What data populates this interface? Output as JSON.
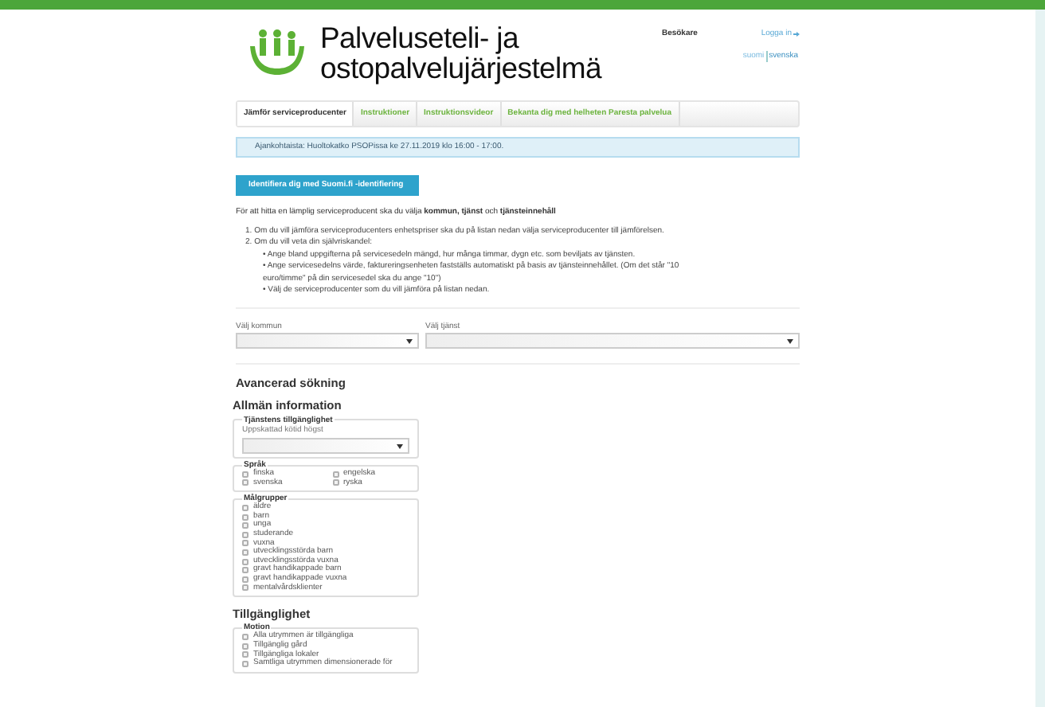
{
  "header": {
    "title_line1": "Palveluseteli- ja",
    "title_line2": "ostopalvelujärjestelmä",
    "user_label": "Besökare",
    "login_link": "Logga in",
    "languages": [
      {
        "label": "suomi",
        "selected": false
      },
      {
        "label": "svenska",
        "selected": true
      }
    ]
  },
  "tabs": [
    {
      "label": "Jämför serviceproducenter",
      "selected": true
    },
    {
      "label": "Instruktioner",
      "selected": false
    },
    {
      "label": "Instruktionsvideor",
      "selected": false
    },
    {
      "label": "Bekanta dig med helheten Paresta palvelua",
      "selected": false
    }
  ],
  "notice": "Ajankohtaista: Huoltokatko PSOPissa ke 27.11.2019 klo 16:00 - 17:00.",
  "identify_button": "Identifiera dig med Suomi.fi -identifiering",
  "intro": "För att hitta en lämplig serviceproducent ska du välja **kommun, tjänst** och **tjänsteinnehåll**",
  "steps": [
    {
      "number": "1.",
      "text": "Om du vill jämföra serviceproducenters enhetspriser ska du på listan nedan välja serviceproducenter till jämförelsen."
    },
    {
      "number": "2.",
      "text": "Om du vill veta din självriskandel:",
      "bullets": [
        {
          "marker": "•",
          "text": "Ange bland uppgifterna på servicesedeln mängd, hur många timmar, dygn etc. som beviljats av tjänsten."
        },
        {
          "marker": "•",
          "text": "Ange servicesedelns värde, faktureringsenheten fastställs automatiskt på basis av tjänsteinnehållet. (Om det står \"10 euro/timme\" på din servicesedel ska du ange \"10\")"
        },
        {
          "marker": "•",
          "text": "Välj de serviceproducenter som du vill jämföra på listan nedan."
        }
      ]
    }
  ],
  "filters": [
    {
      "label": "Välj kommun"
    },
    {
      "label": "Välj tjänst"
    }
  ],
  "advanced_heading": "Avancerad sökning",
  "sections": [
    {
      "heading": "Allmän information",
      "groups": [
        {
          "legend": "Tjänstens tillgänglighet",
          "kind": "select",
          "label": "Uppskattad kötid högst"
        },
        {
          "legend": "Språk",
          "kind": "checkbox_grid",
          "options": [
            {
              "label": "finska",
              "checked": false
            },
            {
              "label": "engelska",
              "checked": false
            },
            {
              "label": "svenska",
              "checked": false
            },
            {
              "label": "ryska",
              "checked": false
            }
          ]
        },
        {
          "legend": "Målgrupper",
          "kind": "checkbox_list",
          "options": [
            {
              "label": "äldre",
              "checked": false
            },
            {
              "label": "barn",
              "checked": false
            },
            {
              "label": "unga",
              "checked": false
            },
            {
              "label": "studerande",
              "checked": false
            },
            {
              "label": "vuxna",
              "checked": false
            },
            {
              "label": "utvecklingsstörda barn",
              "checked": false
            },
            {
              "label": "utvecklingsstörda vuxna",
              "checked": false
            },
            {
              "label": "gravt handikappade barn",
              "checked": false
            },
            {
              "label": "gravt handikappade vuxna",
              "checked": false
            },
            {
              "label": "mentalvårdsklienter",
              "checked": false
            }
          ]
        }
      ]
    },
    {
      "heading": "Tillgänglighet",
      "groups": [
        {
          "legend": "Motion",
          "kind": "checkbox_list",
          "options": [
            {
              "label": "Alla utrymmen är tillgängliga",
              "checked": false
            },
            {
              "label": "Tillgänglig gård",
              "checked": false
            },
            {
              "label": "Tillgängliga lokaler",
              "checked": false
            },
            {
              "label": "Samtliga utrymmen dimensionerade för",
              "checked": false
            }
          ]
        }
      ]
    }
  ]
}
